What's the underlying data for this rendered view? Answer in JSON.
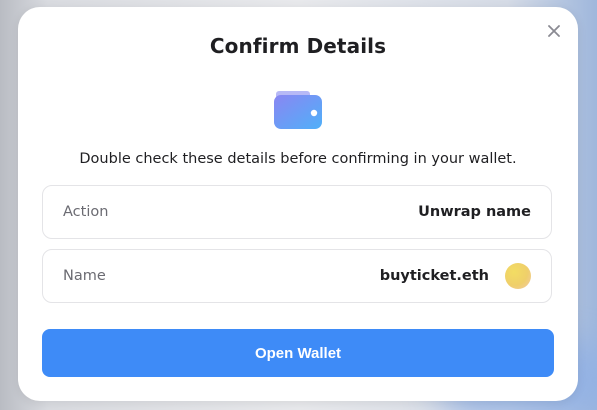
{
  "modal": {
    "title": "Confirm Details",
    "subtitle": "Double check these details before confirming in your wallet.",
    "close_icon": "close-icon",
    "hero_icon": "wallet-icon"
  },
  "details": [
    {
      "label": "Action",
      "value": "Unwrap name"
    },
    {
      "label": "Name",
      "value": "buyticket.eth"
    }
  ],
  "primary_button": {
    "label": "Open Wallet"
  },
  "colors": {
    "accent": "#3e8bf7",
    "wallet_gradient_start": "#7f8cf3",
    "wallet_gradient_end": "#5aa8f8"
  }
}
